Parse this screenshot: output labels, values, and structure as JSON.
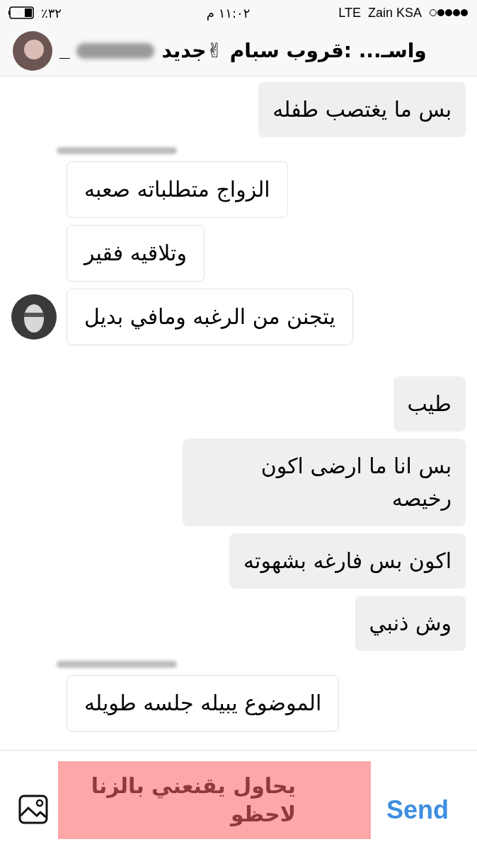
{
  "status_bar": {
    "battery": "٪٣٢",
    "time": "١١:٠٢ م",
    "network": "LTE",
    "carrier": "Zain KSA"
  },
  "header": {
    "title": "واسـ... :قروب سبام ✌جديد",
    "suffix": "_"
  },
  "messages": [
    {
      "kind": "outgoing",
      "text": "بس ما يغتصب طفله"
    },
    {
      "kind": "hidden-name"
    },
    {
      "kind": "incoming",
      "text": "الزواج متطلباته صعبه",
      "avatar": false
    },
    {
      "kind": "incoming",
      "text": "وتلاقيه فقير",
      "avatar": false
    },
    {
      "kind": "incoming",
      "text": "يتجنن من الرغبه ومافي بديل",
      "avatar": true
    },
    {
      "kind": "gap"
    },
    {
      "kind": "outgoing",
      "text": "طيب"
    },
    {
      "kind": "outgoing",
      "text": "بس انا ما ارضى اكون رخيصه"
    },
    {
      "kind": "outgoing",
      "text": "اكون بس فارغه بشهوته"
    },
    {
      "kind": "outgoing",
      "text": "وش ذنبي"
    },
    {
      "kind": "hidden-name"
    },
    {
      "kind": "incoming",
      "text": "الموضوع يبيله جلسه طويله",
      "avatar": false
    }
  ],
  "composer": {
    "note": "يحاول يقنعني بالزنا لاحظو",
    "send": "Send"
  }
}
